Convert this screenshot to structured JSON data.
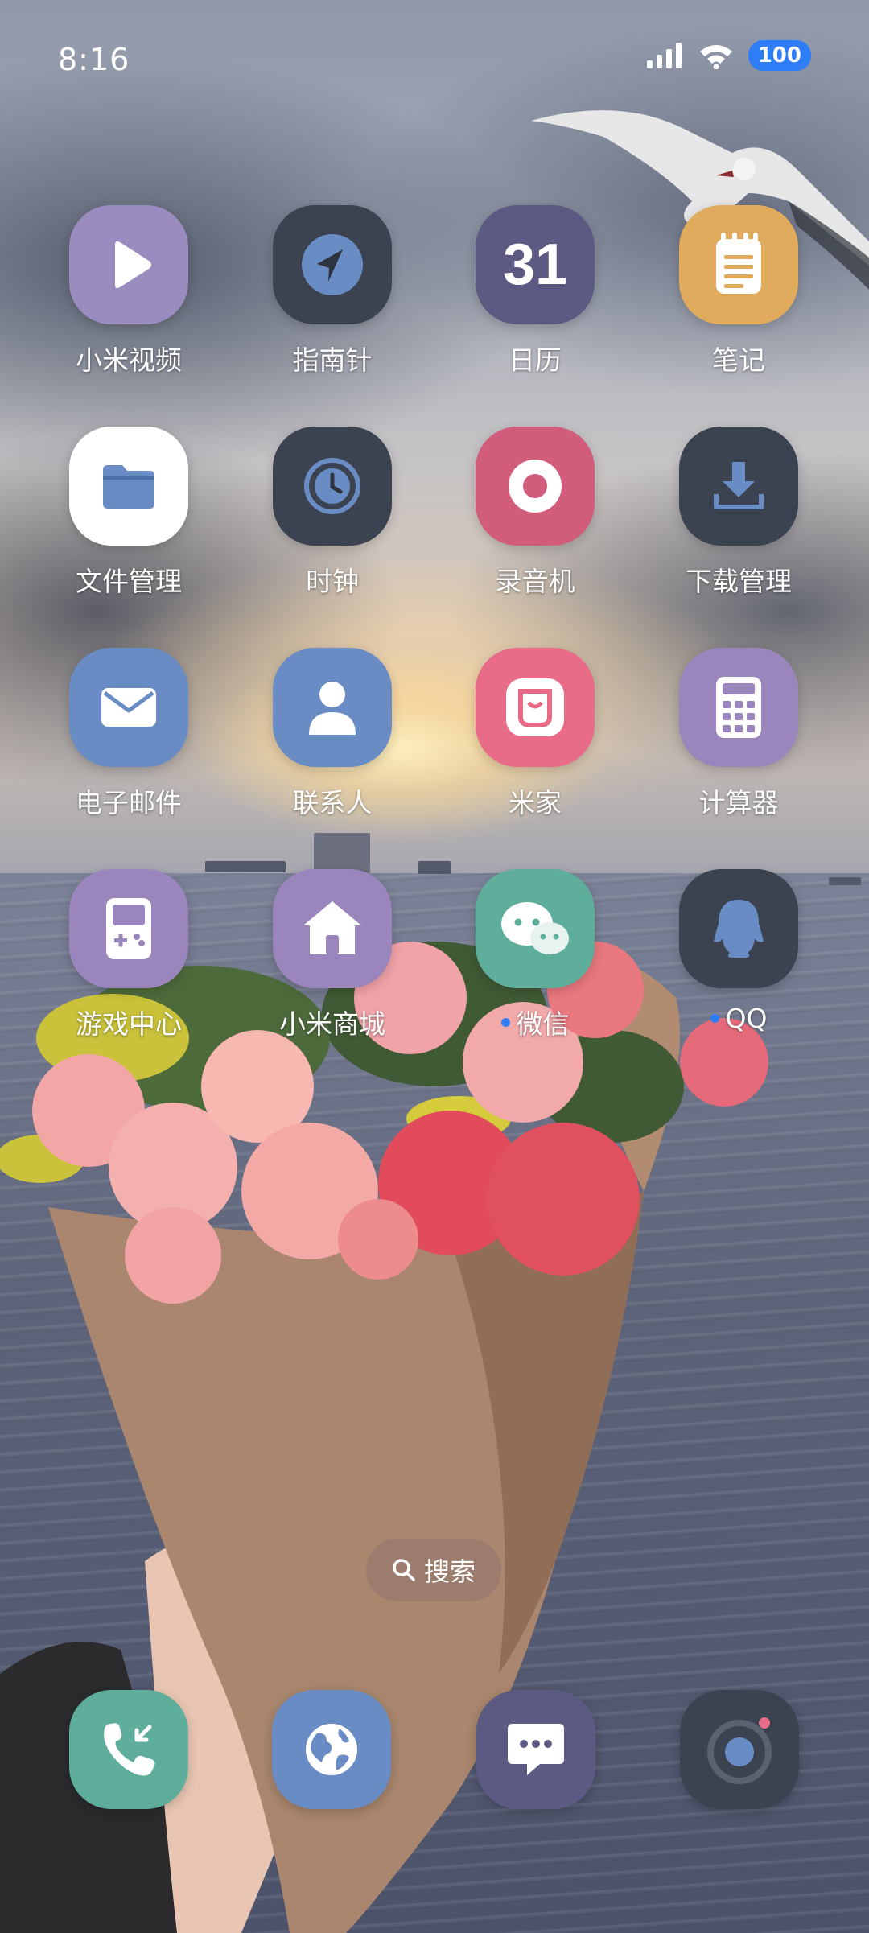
{
  "status_bar": {
    "time": "8:16",
    "battery": "100",
    "icons": [
      "signal-icon",
      "wifi-icon",
      "battery-icon"
    ]
  },
  "apps": [
    {
      "label": "小米视频",
      "icon": "play-icon",
      "color": "#9b8cbf"
    },
    {
      "label": "指南针",
      "icon": "compass-icon",
      "color": "#3b4250"
    },
    {
      "label": "日历",
      "icon": "calendar-icon",
      "color": "#5c5a82",
      "day": "31"
    },
    {
      "label": "笔记",
      "icon": "notes-icon",
      "color": "#e0ab5c"
    },
    {
      "label": "文件管理",
      "icon": "folder-icon",
      "color": "#ffffff"
    },
    {
      "label": "时钟",
      "icon": "clock-icon",
      "color": "#3b4250"
    },
    {
      "label": "录音机",
      "icon": "record-icon",
      "color": "#d25c7c"
    },
    {
      "label": "下载管理",
      "icon": "download-icon",
      "color": "#3b4250"
    },
    {
      "label": "电子邮件",
      "icon": "mail-icon",
      "color": "#6a8cc4"
    },
    {
      "label": "联系人",
      "icon": "contact-icon",
      "color": "#6a8cc4"
    },
    {
      "label": "米家",
      "icon": "mijia-icon",
      "color": "#e86b88"
    },
    {
      "label": "计算器",
      "icon": "calculator-icon",
      "color": "#9a86bd"
    },
    {
      "label": "游戏中心",
      "icon": "gamepad-icon",
      "color": "#9a86bd"
    },
    {
      "label": "小米商城",
      "icon": "home-icon",
      "color": "#9a86bd"
    },
    {
      "label": "微信",
      "icon": "wechat-icon",
      "color": "#5fae9b",
      "badge": true
    },
    {
      "label": "QQ",
      "icon": "qq-icon",
      "color": "#3b4250",
      "badge": true
    }
  ],
  "search": {
    "label": "搜索"
  },
  "dock": [
    {
      "icon": "phone-icon",
      "color": "#5fae9b"
    },
    {
      "icon": "browser-icon",
      "color": "#6a8cc4"
    },
    {
      "icon": "messages-icon",
      "color": "#5c5a82"
    },
    {
      "icon": "camera-icon",
      "color": "#3b4250"
    }
  ]
}
